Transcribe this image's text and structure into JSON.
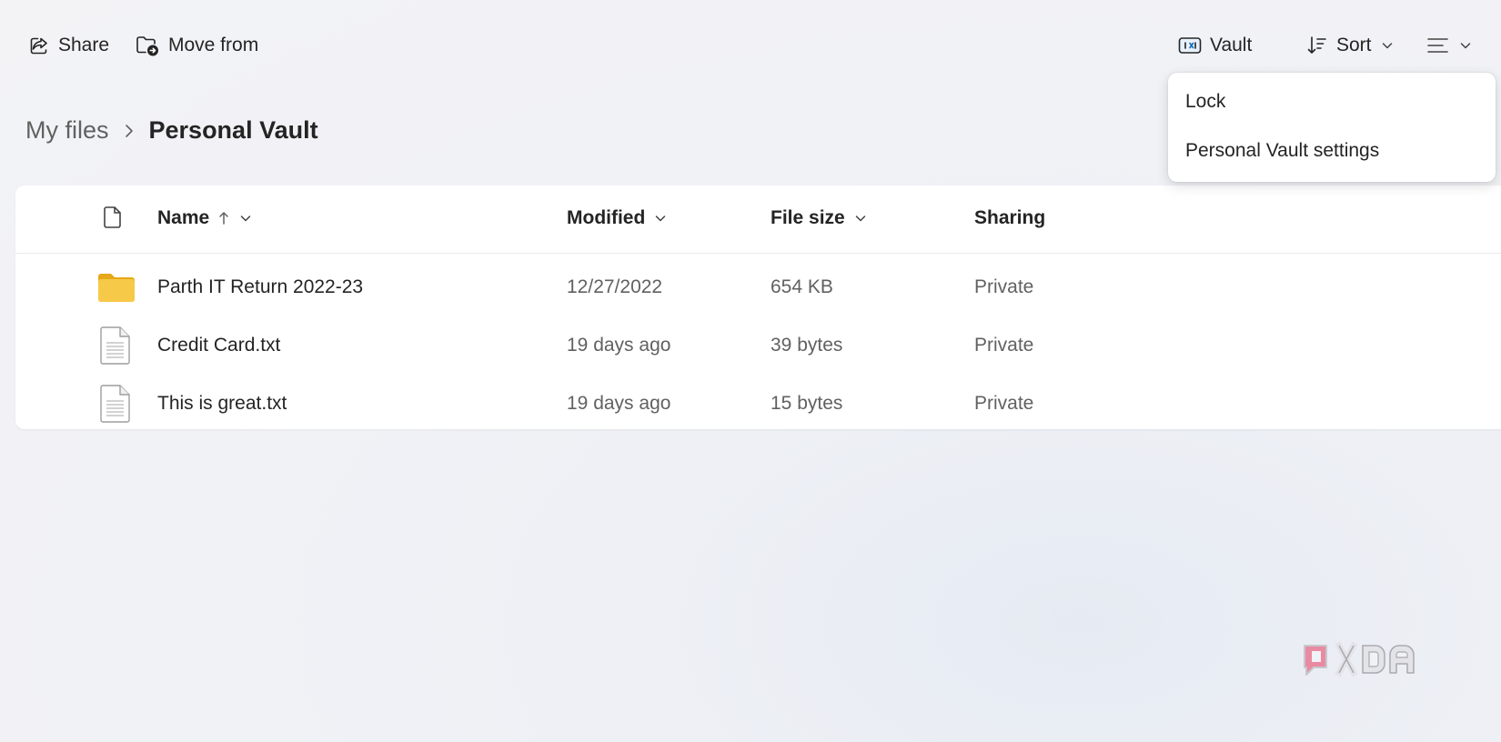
{
  "toolbar": {
    "share_label": "Share",
    "move_from_label": "Move from",
    "vault_label": "Vault",
    "sort_label": "Sort"
  },
  "breadcrumb": {
    "root": "My files",
    "current": "Personal Vault"
  },
  "columns": {
    "name": "Name",
    "modified": "Modified",
    "file_size": "File size",
    "sharing": "Sharing"
  },
  "files": [
    {
      "name": "Parth IT Return 2022-23",
      "modified": "12/27/2022",
      "size": "654 KB",
      "sharing": "Private",
      "icon": "folder-icon"
    },
    {
      "name": "Credit Card.txt",
      "modified": "19 days ago",
      "size": "39 bytes",
      "sharing": "Private",
      "icon": "text-file-icon"
    },
    {
      "name": "This is great.txt",
      "modified": "19 days ago",
      "size": "15 bytes",
      "sharing": "Private",
      "icon": "text-file-icon"
    }
  ],
  "vault_menu": {
    "items": [
      "Lock",
      "Personal Vault settings"
    ]
  },
  "watermark": {
    "text": "XDA"
  },
  "colors": {
    "accent": "#0f6cbd",
    "folder": "#f7c948",
    "background": "#f1f2f6"
  }
}
